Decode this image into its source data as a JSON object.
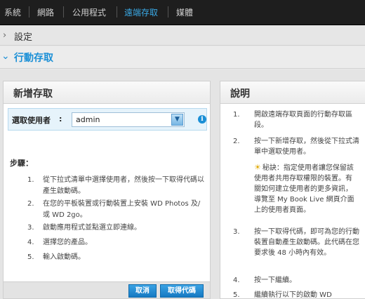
{
  "nav": {
    "items": [
      {
        "label": "系統",
        "active": false
      },
      {
        "label": "網路",
        "active": false
      },
      {
        "label": "公用程式",
        "active": false
      },
      {
        "label": "遠端存取",
        "active": true
      },
      {
        "label": "媒體",
        "active": false
      }
    ]
  },
  "sections": {
    "settings": "設定",
    "mobile_access": "行動存取"
  },
  "left_panel": {
    "title": "新增存取",
    "select_user_label": "選取使用者",
    "select_user_colon": ":",
    "selected_user": "admin",
    "steps_title": "步驟：",
    "steps": [
      {
        "num": "1.",
        "text": "從下拉式清單中選擇使用者，然後按一下取得代碼以產生啟動碼。"
      },
      {
        "num": "2.",
        "text": "在您的平板裝置或行動裝置上安裝 WD Photos 及/或 WD 2go。"
      },
      {
        "num": "3.",
        "text": "啟動應用程式並點選立即連線。"
      },
      {
        "num": "4.",
        "text": "選擇您的產品。"
      },
      {
        "num": "5.",
        "text": "輸入啟動碼。"
      }
    ],
    "cancel_label": "取消",
    "get_code_label": "取得代碼"
  },
  "right_panel": {
    "title": "說明",
    "items": [
      {
        "num": "1.",
        "text": "開啟遠端存取頁面的行動存取區段。"
      },
      {
        "num": "2.",
        "text": "按一下新增存取，然後從下拉式清單中選取使用者。"
      },
      {
        "num": "3.",
        "text": "按一下取得代碼，即可為您的行動裝置自動產生啟動碼。此代碼在您要求後 48 小時內有效。"
      },
      {
        "num": "4.",
        "text": "按一下繼續。"
      },
      {
        "num": "5.",
        "text": "繼續執行以下的啟動 WD"
      }
    ],
    "tip": "秘訣：指定使用者讓您保留該使用者共用存取權限的裝置。有關如何建立使用者的更多資訊，導覽至 My Book Live 網頁介面上的使用者頁面。"
  },
  "icons": {
    "expand": "chevron-right-icon",
    "collapse": "chevron-down-icon",
    "info": "info-icon",
    "tip": "lightbulb-icon"
  },
  "colors": {
    "accent": "#1a8fd6",
    "nav_bg": "#1e1e1e",
    "button": "#1679c2"
  }
}
